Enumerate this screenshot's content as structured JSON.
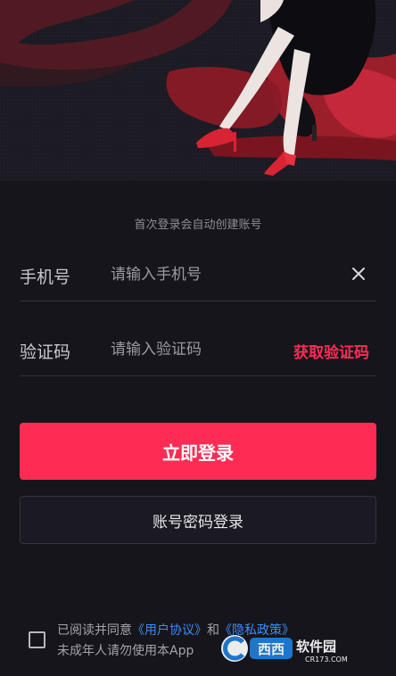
{
  "hint": "首次登录会自动创建账号",
  "phone": {
    "label": "手机号",
    "placeholder": "请输入手机号",
    "value": ""
  },
  "code": {
    "label": "验证码",
    "placeholder": "请输入验证码",
    "value": "",
    "get_code_label": "获取验证码"
  },
  "primary_button": "立即登录",
  "secondary_button": "账号密码登录",
  "agreement": {
    "prefix": "已阅读并同意",
    "user_agreement": "《用户协议》",
    "and": "和",
    "privacy_policy": "《隐私政策》",
    "line2": "未成年人请勿使用本App",
    "checked": false
  },
  "watermark": {
    "brand": "西西软件园",
    "site": "CR173.COM"
  },
  "colors": {
    "background": "#16151c",
    "accent": "#fe2c55",
    "link": "#3d8df5"
  }
}
